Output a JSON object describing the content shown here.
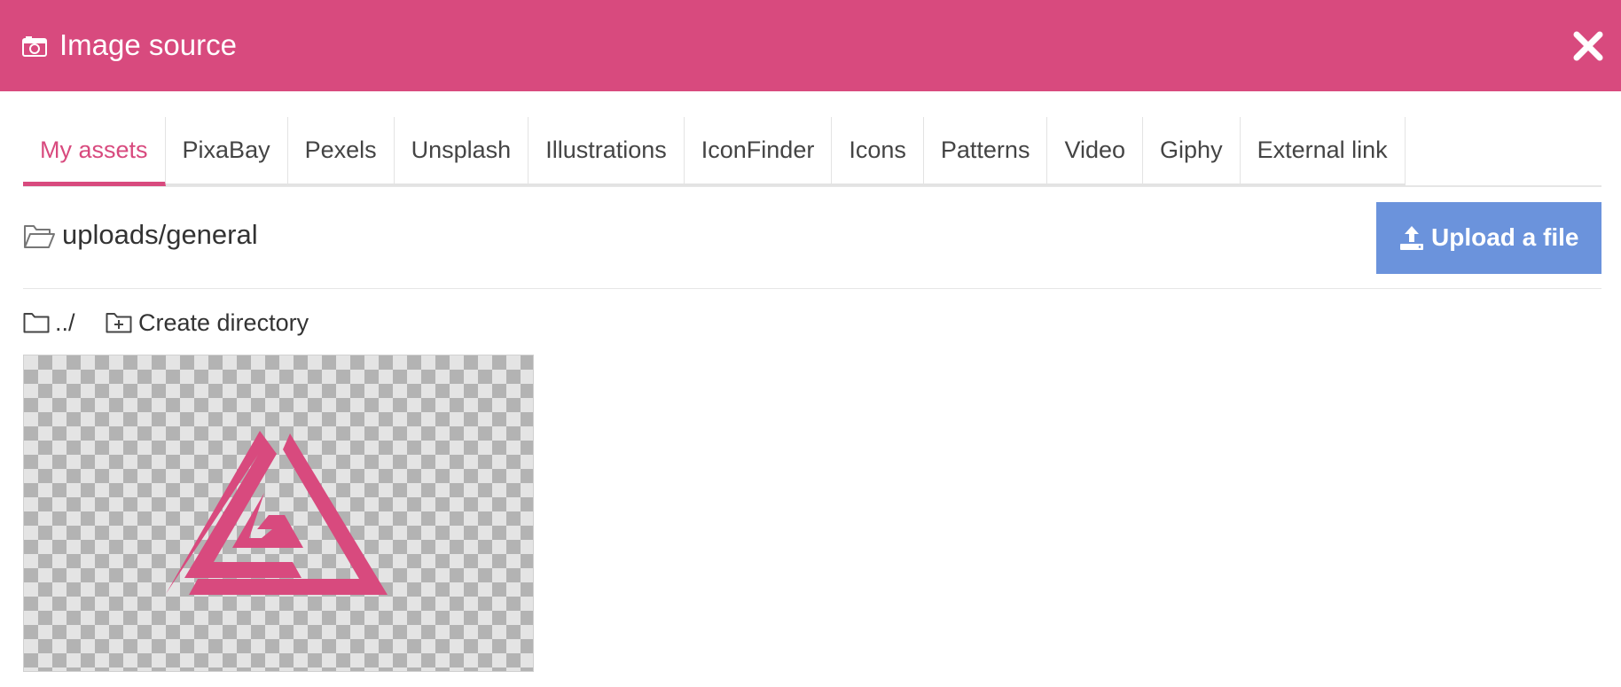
{
  "header": {
    "title": "Image source",
    "icon": "camera-icon",
    "close_icon": "close-icon",
    "background_color": "#d84a7e"
  },
  "tabs": [
    {
      "label": "My assets",
      "active": true
    },
    {
      "label": "PixaBay",
      "active": false
    },
    {
      "label": "Pexels",
      "active": false
    },
    {
      "label": "Unsplash",
      "active": false
    },
    {
      "label": "Illustrations",
      "active": false
    },
    {
      "label": "IconFinder",
      "active": false
    },
    {
      "label": "Icons",
      "active": false
    },
    {
      "label": "Patterns",
      "active": false
    },
    {
      "label": "Video",
      "active": false
    },
    {
      "label": "Giphy",
      "active": false
    },
    {
      "label": "External link",
      "active": false
    }
  ],
  "path": {
    "icon": "folder-open-icon",
    "current": "uploads/general"
  },
  "upload": {
    "label": "Upload a file",
    "icon": "upload-icon",
    "color": "#6b93dc"
  },
  "directory_actions": {
    "up_label": "../",
    "up_icon": "folder-icon",
    "create_label": "Create directory",
    "create_icon": "folder-plus-icon"
  },
  "assets": [
    {
      "kind": "image",
      "transparent_background": true,
      "logo_color": "#d84a7e"
    }
  ],
  "colors": {
    "accent": "#d84a7e",
    "button": "#6b93dc",
    "text": "#333333",
    "tab_text": "#444444"
  }
}
